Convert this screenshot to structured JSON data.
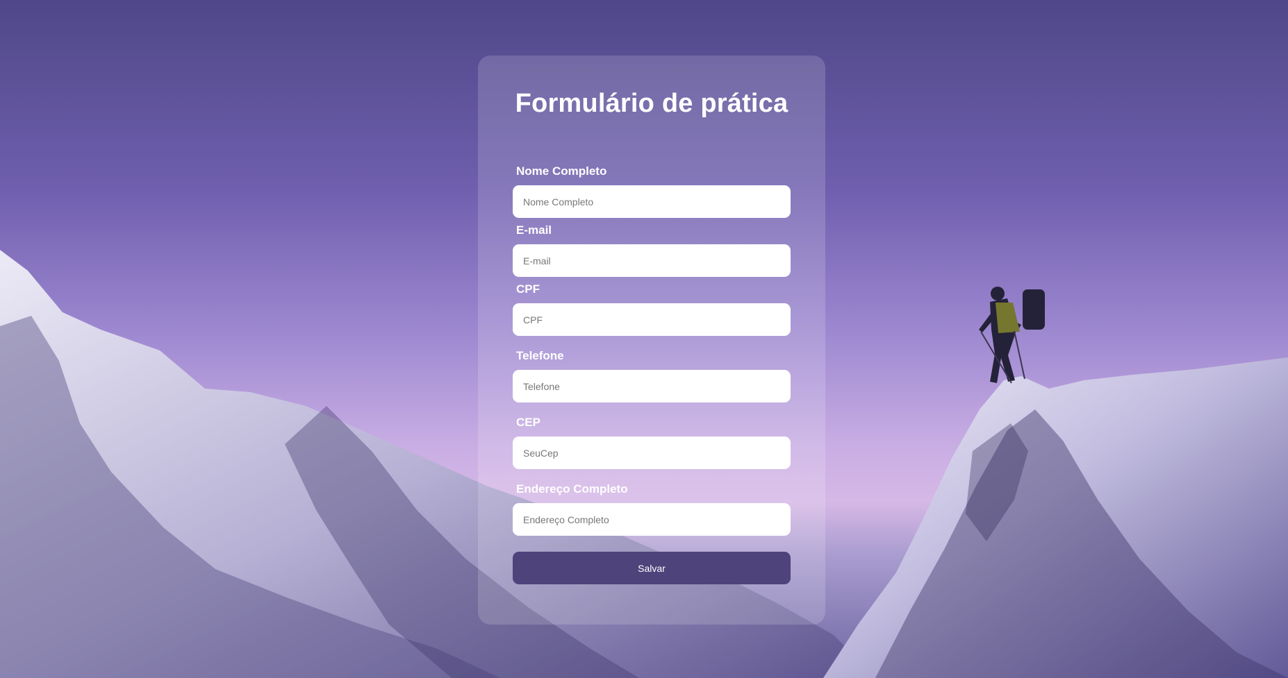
{
  "form": {
    "title": "Formulário de prática",
    "fields": [
      {
        "label": "Nome Completo",
        "placeholder": "Nome Completo"
      },
      {
        "label": "E-mail",
        "placeholder": "E-mail"
      },
      {
        "label": "CPF",
        "placeholder": "CPF"
      },
      {
        "label": "Telefone",
        "placeholder": "Telefone"
      },
      {
        "label": "CEP",
        "placeholder": "SeuCep"
      },
      {
        "label": "Endereço Completo",
        "placeholder": "Endereço Completo"
      }
    ],
    "submit_label": "Salvar"
  },
  "colors": {
    "button": "#4f437c",
    "text": "#ffffff"
  }
}
